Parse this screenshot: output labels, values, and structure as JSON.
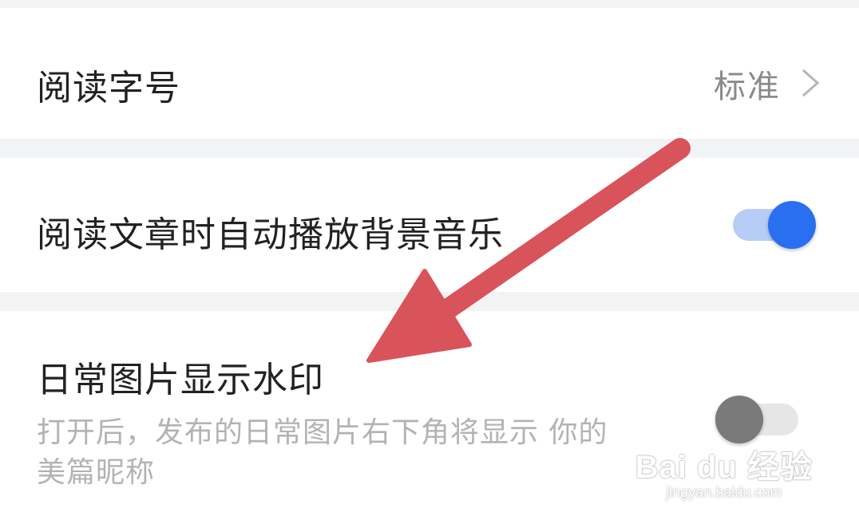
{
  "settings": {
    "font_size": {
      "label": "阅读字号",
      "value": "标准",
      "chevron_icon": "chevron-right-icon"
    },
    "bg_music": {
      "label": "阅读文章时自动播放背景音乐",
      "enabled": true
    },
    "watermark": {
      "label": "日常图片显示水印",
      "description": "打开后，发布的日常图片右下角将显示 你的美篇昵称",
      "enabled": false
    }
  },
  "annotation": {
    "arrow_color": "#d9535a",
    "arrow_icon": "annotation-arrow"
  },
  "site_watermark": {
    "logo_text": "Bai du 经验",
    "url": "jingyan.baidu.com"
  },
  "colors": {
    "accent": "#2a6ff0",
    "background": "#f2f3f5"
  }
}
